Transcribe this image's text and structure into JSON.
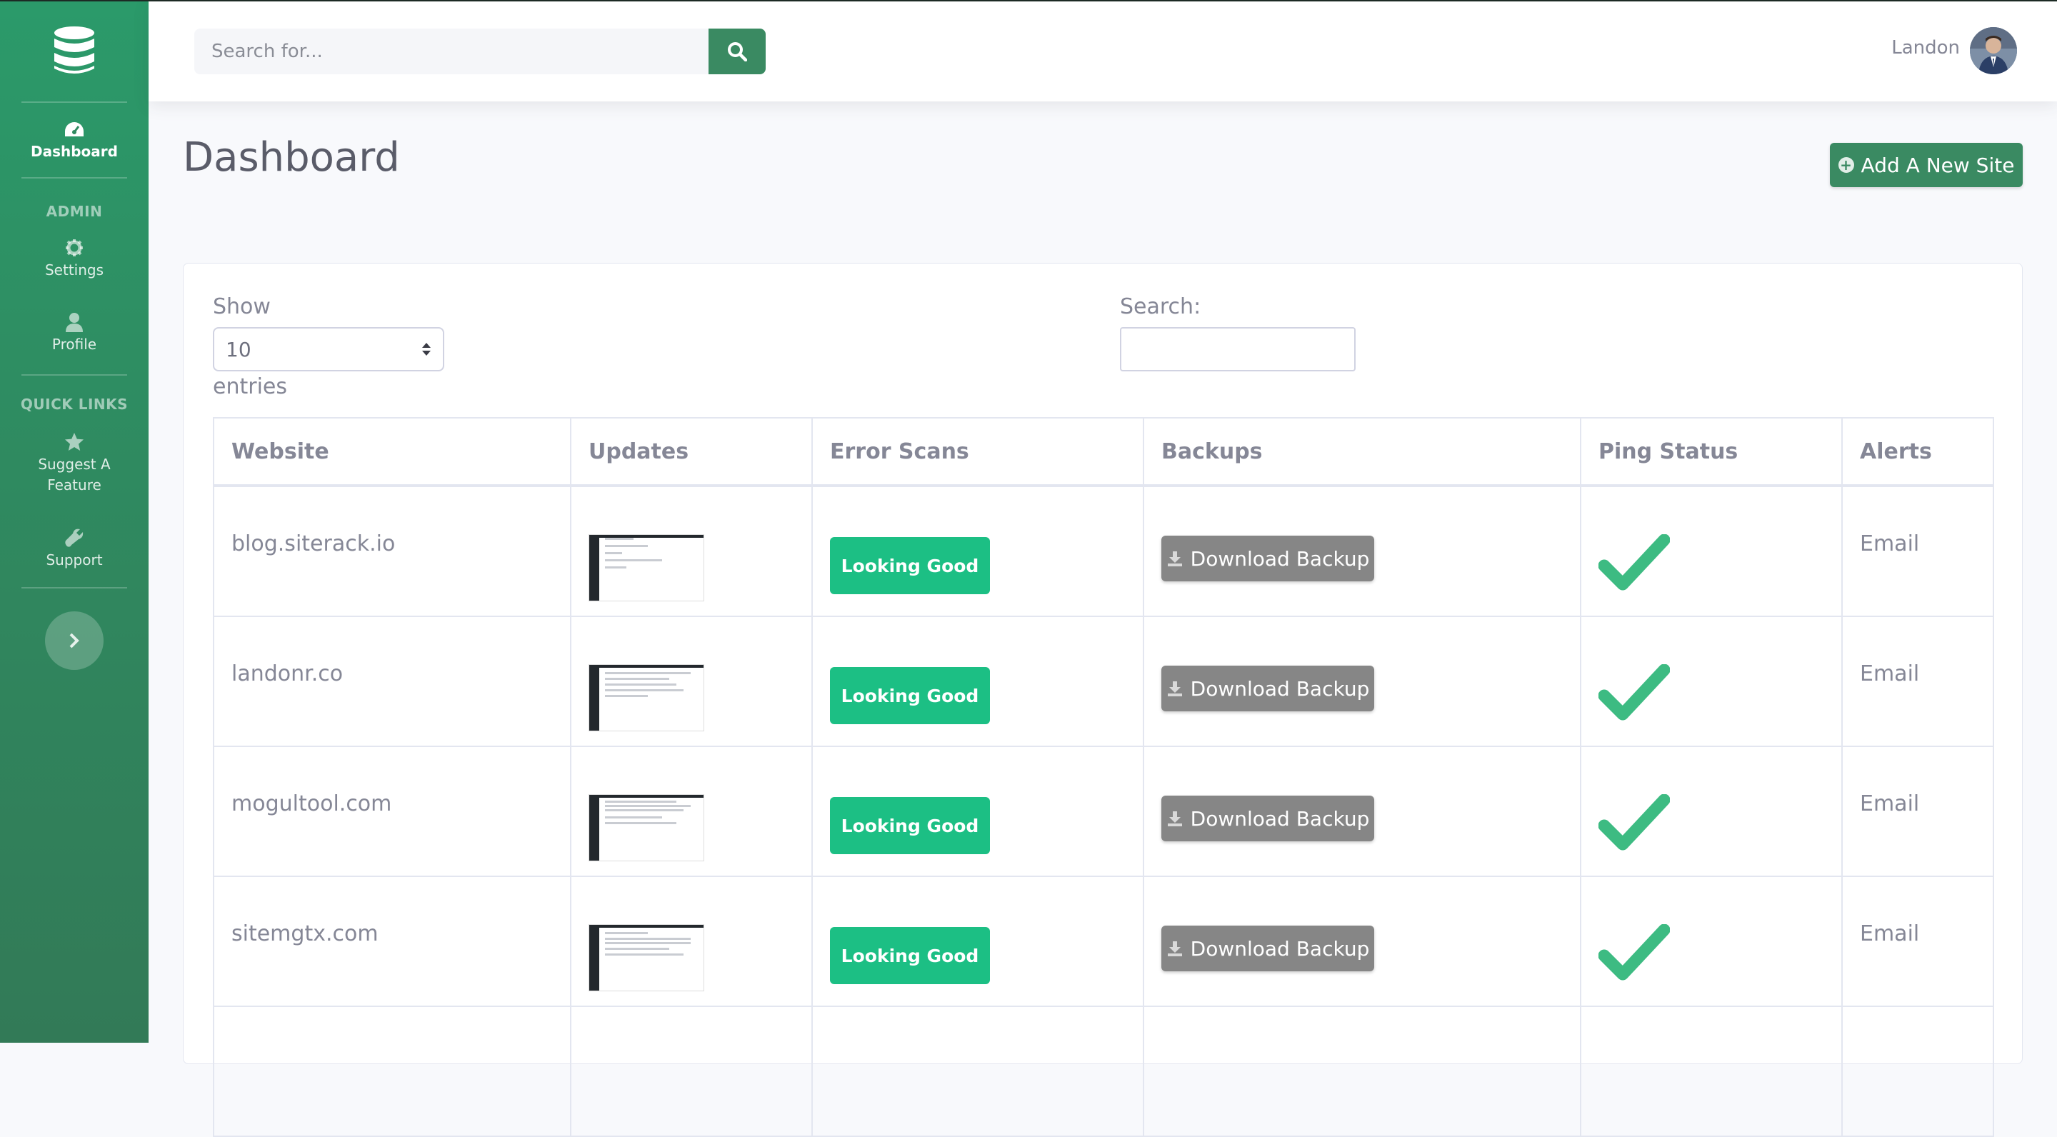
{
  "sidebar": {
    "brand_icon": "database-icon",
    "items": [
      {
        "label": "Dashboard",
        "icon": "tachometer-icon",
        "active": true
      },
      {
        "label": "Settings",
        "icon": "gear-icon"
      },
      {
        "label": "Profile",
        "icon": "user-icon"
      },
      {
        "label": "Suggest A\nFeature",
        "icon": "star-icon"
      },
      {
        "label": "Support",
        "icon": "wrench-icon"
      }
    ],
    "headings": {
      "admin": "ADMIN",
      "quick_links": "QUICK LINKS"
    },
    "toggle_icon": "chevron-right-icon"
  },
  "topbar": {
    "search_placeholder": "Search for...",
    "search_icon": "search-icon",
    "user_name": "Landon"
  },
  "page": {
    "title": "Dashboard",
    "add_button": "Add A New Site"
  },
  "table_controls": {
    "show_label": "Show",
    "length_value": "10",
    "entries_label": "entries",
    "search_label": "Search:"
  },
  "table": {
    "columns": [
      "Website",
      "Updates",
      "Error Scans",
      "Backups",
      "Ping Status",
      "Alerts"
    ],
    "rows": [
      {
        "website": "blog.siterack.io",
        "error_scan": "Looking Good",
        "backup": "Download Backup",
        "alerts": "Email"
      },
      {
        "website": "landonr.co",
        "error_scan": "Looking Good",
        "backup": "Download Backup",
        "alerts": "Email"
      },
      {
        "website": "mogultool.com",
        "error_scan": "Looking Good",
        "backup": "Download Backup",
        "alerts": "Email"
      },
      {
        "website": "sitemgtx.com",
        "error_scan": "Looking Good",
        "backup": "Download Backup",
        "alerts": "Email"
      }
    ]
  },
  "colors": {
    "brand_green": "#3a8a62",
    "status_green": "#1cbf84",
    "check_green": "#3dbb82",
    "backup_gray": "#868686"
  }
}
